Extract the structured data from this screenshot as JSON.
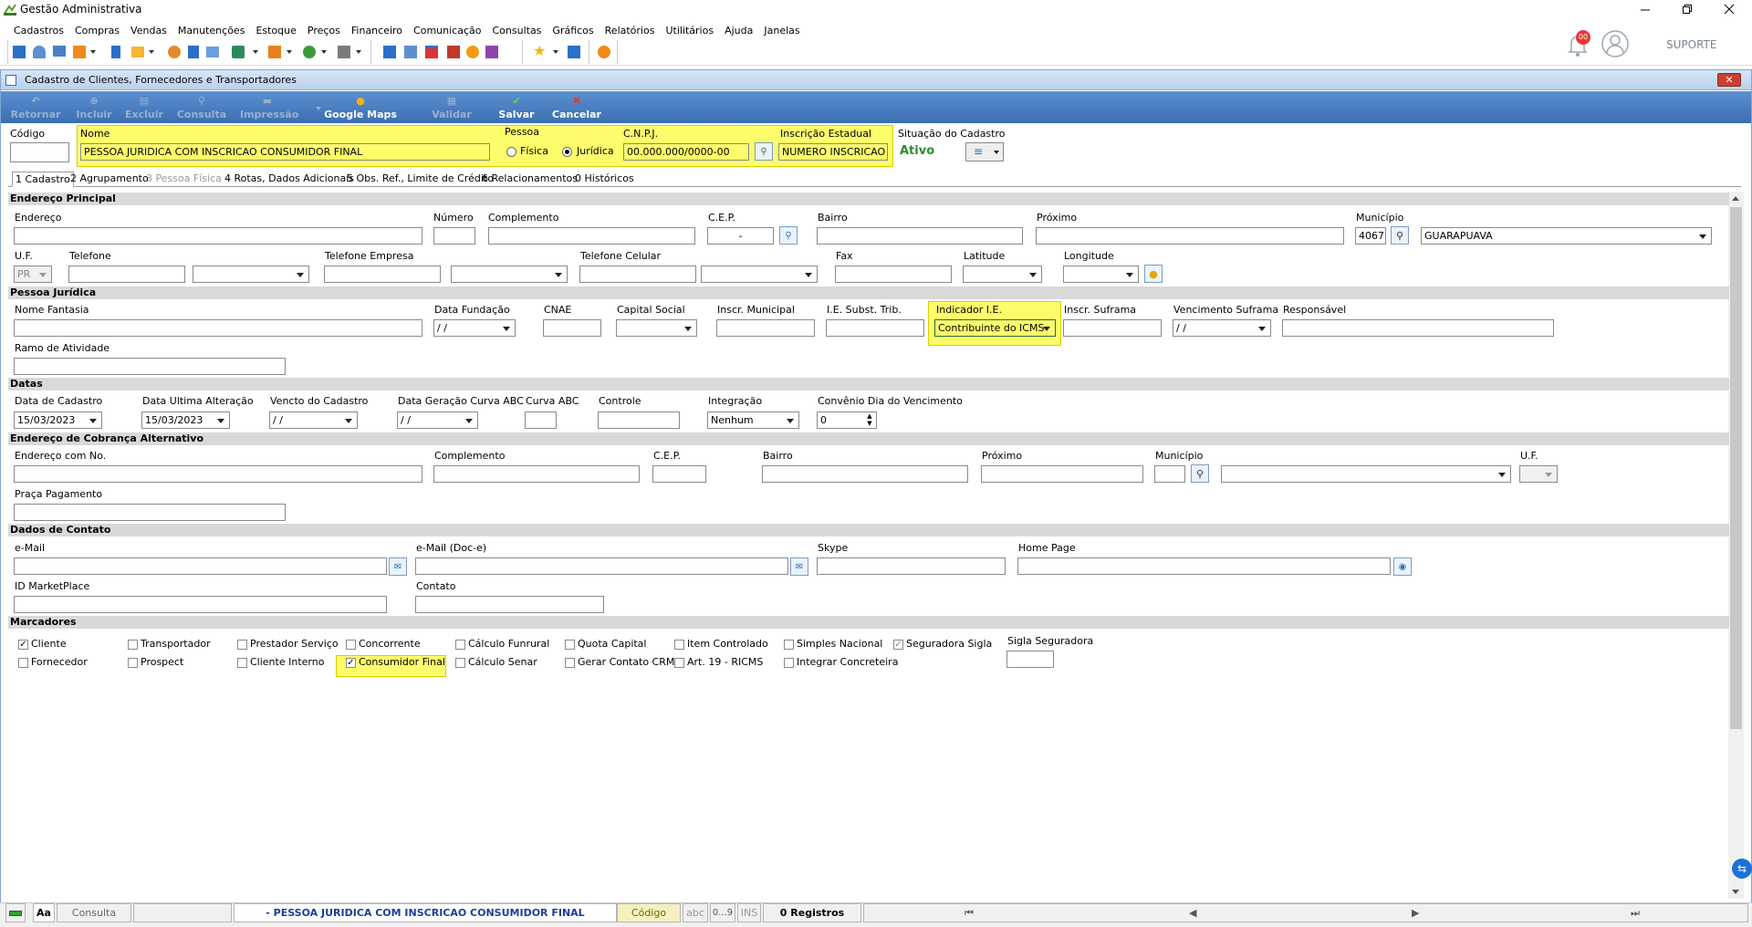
{
  "window": {
    "title": "Gestão Administrativa",
    "user": "SUPORTE",
    "notif_count": "00"
  },
  "menu": [
    "Cadastros",
    "Compras",
    "Vendas",
    "Manutenções",
    "Estoque",
    "Preços",
    "Financeiro",
    "Comunicação",
    "Consultas",
    "Gráficos",
    "Relatórios",
    "Utilitários",
    "Ajuda",
    "Janelas"
  ],
  "child": {
    "title": "Cadastro de Clientes, Fornecedores e Transportadores"
  },
  "actions": {
    "retornar": "Retornar",
    "incluir": "Incluir",
    "excluir": "Excluir",
    "consulta": "Consulta",
    "impressao": "Impressão",
    "maps": "Google Maps",
    "validar": "Validar",
    "salvar": "Salvar",
    "cancelar": "Cancelar"
  },
  "header": {
    "codigo_label": "Código",
    "codigo": "",
    "nome_label": "Nome",
    "nome": "PESSOA JURIDICA COM INSCRICAO CONSUMIDOR FINAL",
    "pessoa_label": "Pessoa",
    "fisica": "Física",
    "juridica": "Jurídica",
    "cnpj_label": "C.N.P.J.",
    "cnpj": "00.000.000/0000-00",
    "ie_label": "Inscrição Estadual",
    "ie": "NUMERO INSCRICAO",
    "situacao_label": "Situação do Cadastro",
    "situacao": "Ativo"
  },
  "tabs": [
    "1 Cadastro",
    "2 Agrupamento",
    "3 Pessoa Física",
    "4 Rotas, Dados Adicionais",
    "5 Obs. Ref., Limite de Crédito",
    "6 Relacionamentos",
    "0 Históricos"
  ],
  "sections": {
    "endereco": "Endereço Principal",
    "pj": "Pessoa Jurídica",
    "datas": "Datas",
    "cobranca": "Endereço de Cobrança Alternativo",
    "contato": "Dados de Contato",
    "marcadores": "Marcadores"
  },
  "end": {
    "endereco": "Endereço",
    "numero": "Número",
    "complemento": "Complemento",
    "cep": "C.E.P.",
    "cep_val": "-",
    "bairro": "Bairro",
    "proximo": "Próximo",
    "municipio": "Município",
    "mun_cod": "4067",
    "mun_nome": "GUARAPUAVA",
    "uf": "U.F.",
    "uf_val": "PR",
    "telefone": "Telefone",
    "tel_empresa": "Telefone Empresa",
    "tel_celular": "Telefone Celular",
    "fax": "Fax",
    "latitude": "Latitude",
    "longitude": "Longitude"
  },
  "pj": {
    "fantasia": "Nome Fantasia",
    "data_fund": "Data Fundação",
    "data_fund_val": "/ /",
    "cnae": "CNAE",
    "capital": "Capital Social",
    "inscr_mun": "Inscr. Municipal",
    "ie_subst": "I.E. Subst. Trib.",
    "ind_ie": "Indicador I.E.",
    "ind_ie_val": "Contribuinte do ICMS",
    "suframa": "Inscr. Suframa",
    "venc_suframa": "Vencimento Suframa",
    "venc_suframa_val": "/ /",
    "responsavel": "Responsável",
    "ramo": "Ramo de Atividade"
  },
  "datas": {
    "cadastro": "Data de Cadastro",
    "cadastro_val": "15/03/2023",
    "ult_alt": "Data Ultima Alteração",
    "ult_alt_val": "15/03/2023",
    "vencto": "Vencto do Cadastro",
    "vencto_val": "/ /",
    "curva_data": "Data Geração Curva ABC",
    "curva_data_val": "/ /",
    "curva": "Curva ABC",
    "controle": "Controle",
    "integracao": "Integração",
    "integracao_val": "Nenhum",
    "convenio": "Convênio Dia do Vencimento",
    "convenio_val": "0"
  },
  "cob": {
    "endereco": "Endereço com No.",
    "complemento": "Complemento",
    "cep": "C.E.P.",
    "bairro": "Bairro",
    "proximo": "Próximo",
    "municipio": "Município",
    "uf": "U.F.",
    "praca": "Praça Pagamento"
  },
  "contato": {
    "email": "e-Mail",
    "email_doc": "e-Mail (Doc-e)",
    "skype": "Skype",
    "home": "Home Page",
    "id_mkt": "ID MarketPlace",
    "contato": "Contato"
  },
  "marcadores": [
    {
      "label": "Cliente",
      "checked": true,
      "col": 0,
      "row": 0
    },
    {
      "label": "Transportador",
      "checked": false,
      "col": 1,
      "row": 0
    },
    {
      "label": "Prestador Serviço",
      "checked": false,
      "col": 2,
      "row": 0
    },
    {
      "label": "Concorrente",
      "checked": false,
      "col": 3,
      "row": 0
    },
    {
      "label": "Cálculo Funrural",
      "checked": false,
      "col": 4,
      "row": 0
    },
    {
      "label": "Quota Capital",
      "checked": false,
      "col": 5,
      "row": 0
    },
    {
      "label": "Item Controlado",
      "checked": false,
      "col": 6,
      "row": 0
    },
    {
      "label": "Simples Nacional",
      "checked": false,
      "col": 7,
      "row": 0
    },
    {
      "label": "Seguradora Sigla",
      "checked": true,
      "col": 8,
      "row": 0
    },
    {
      "label": "Fornecedor",
      "checked": false,
      "col": 0,
      "row": 1
    },
    {
      "label": "Prospect",
      "checked": false,
      "col": 1,
      "row": 1
    },
    {
      "label": "Cliente Interno",
      "checked": false,
      "col": 2,
      "row": 1
    },
    {
      "label": "Consumidor Final",
      "checked": true,
      "col": 3,
      "row": 1
    },
    {
      "label": "Cálculo Senar",
      "checked": false,
      "col": 4,
      "row": 1
    },
    {
      "label": "Gerar Contato CRM",
      "checked": false,
      "col": 5,
      "row": 1
    },
    {
      "label": "Art. 19 - RICMS",
      "checked": false,
      "col": 6,
      "row": 1
    },
    {
      "label": "Integrar Concreteira",
      "checked": false,
      "col": 7,
      "row": 1
    }
  ],
  "sigla_label": "Sigla Seguradora",
  "status": {
    "aa": "Aa",
    "mode": "Consulta",
    "record": "- PESSOA JURIDICA COM INSCRICAO CONSUMIDOR FINAL",
    "key": "Código",
    "abc": "abc",
    "num": "0...9",
    "ins": "INS",
    "count": "0 Registros"
  }
}
